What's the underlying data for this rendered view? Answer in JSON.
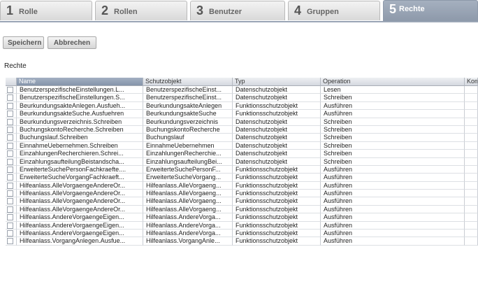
{
  "wizard": {
    "steps": [
      {
        "number": "1",
        "label": "Rolle"
      },
      {
        "number": "2",
        "label": "Rollen"
      },
      {
        "number": "3",
        "label": "Benutzer"
      },
      {
        "number": "4",
        "label": "Gruppen"
      },
      {
        "number": "5",
        "label": "Rechte"
      }
    ],
    "active_step": 5
  },
  "toolbar": {
    "save_label": "Speichern",
    "cancel_label": "Abbrechen"
  },
  "section": {
    "title": "Rechte"
  },
  "table": {
    "columns": [
      "",
      "Name",
      "Schutzobjekt",
      "Typ",
      "Operation",
      "Kom"
    ],
    "sorted_column": "Name",
    "rows": [
      [
        "BenutzerspezifischeEinstellungen.L...",
        "BenutzerspezifischeEinst...",
        "Datenschutzobjekt",
        "Lesen"
      ],
      [
        "BenutzerspezifischeEinstellungen.S...",
        "BenutzerspezifischeEinst...",
        "Datenschutzobjekt",
        "Schreiben"
      ],
      [
        "BeurkundungsakteAnlegen.Ausfueh...",
        "BeurkundungsakteAnlegen",
        "Funktionsschutzobjekt",
        "Ausführen"
      ],
      [
        "BeurkundungsakteSuche.Ausfuehren",
        "BeurkundungsakteSuche",
        "Funktionsschutzobjekt",
        "Ausführen"
      ],
      [
        "Beurkundungsverzeichnis.Schreiben",
        "Beurkundungsverzeichnis",
        "Datenschutzobjekt",
        "Schreiben"
      ],
      [
        "BuchungskontoRecherche.Schreiben",
        "BuchungskontoRecherche",
        "Datenschutzobjekt",
        "Schreiben"
      ],
      [
        "Buchungslauf.Schreiben",
        "Buchungslauf",
        "Datenschutzobjekt",
        "Schreiben"
      ],
      [
        "EinnahmeUebernehmen.Schreiben",
        "EinnahmeUebernehmen",
        "Datenschutzobjekt",
        "Schreiben"
      ],
      [
        "EinzahlungenRecherchieren.Schrei...",
        "EinzahlungenRecherchie...",
        "Datenschutzobjekt",
        "Schreiben"
      ],
      [
        "EinzahlungsaufteilungBeistandscha...",
        "EinzahlungsaufteilungBei...",
        "Datenschutzobjekt",
        "Schreiben"
      ],
      [
        "ErweiterteSuchePersonFachkraefte....",
        "ErweiterteSuchePersonF...",
        "Funktionsschutzobjekt",
        "Ausführen"
      ],
      [
        "ErweiterteSucheVorgangFachkraeft...",
        "ErweiterteSucheVorgang...",
        "Funktionsschutzobjekt",
        "Ausführen"
      ],
      [
        "Hilfeanlass.AlleVorgaengeAndereOr...",
        "Hilfeanlass.AlleVorgaeng...",
        "Funktionsschutzobjekt",
        "Ausführen"
      ],
      [
        "Hilfeanlass.AlleVorgaengeAndereOr...",
        "Hilfeanlass.AlleVorgaeng...",
        "Funktionsschutzobjekt",
        "Ausführen"
      ],
      [
        "Hilfeanlass.AlleVorgaengeAndereOr...",
        "Hilfeanlass.AlleVorgaeng...",
        "Funktionsschutzobjekt",
        "Ausführen"
      ],
      [
        "Hilfeanlass.AlleVorgaengeAndereOr...",
        "Hilfeanlass.AlleVorgaeng...",
        "Funktionsschutzobjekt",
        "Ausführen"
      ],
      [
        "Hilfeanlass.AndereVorgaengeEigen...",
        "Hilfeanlass.AndereVorga...",
        "Funktionsschutzobjekt",
        "Ausführen"
      ],
      [
        "Hilfeanlass.AndereVorgaengeEigen...",
        "Hilfeanlass.AndereVorga...",
        "Funktionsschutzobjekt",
        "Ausführen"
      ],
      [
        "Hilfeanlass.AndereVorgaengeEigen...",
        "Hilfeanlass.AndereVorga...",
        "Funktionsschutzobjekt",
        "Ausführen"
      ],
      [
        "Hilfeanlass.VorgangAnlegen.Ausfue...",
        "Hilfeanlass.VorgangAnle...",
        "Funktionsschutzobjekt",
        "Ausführen"
      ]
    ]
  },
  "colors": {
    "active_step": "#8d99aa",
    "sorted_header": "#8594aa",
    "border": "#9aa5b5"
  }
}
